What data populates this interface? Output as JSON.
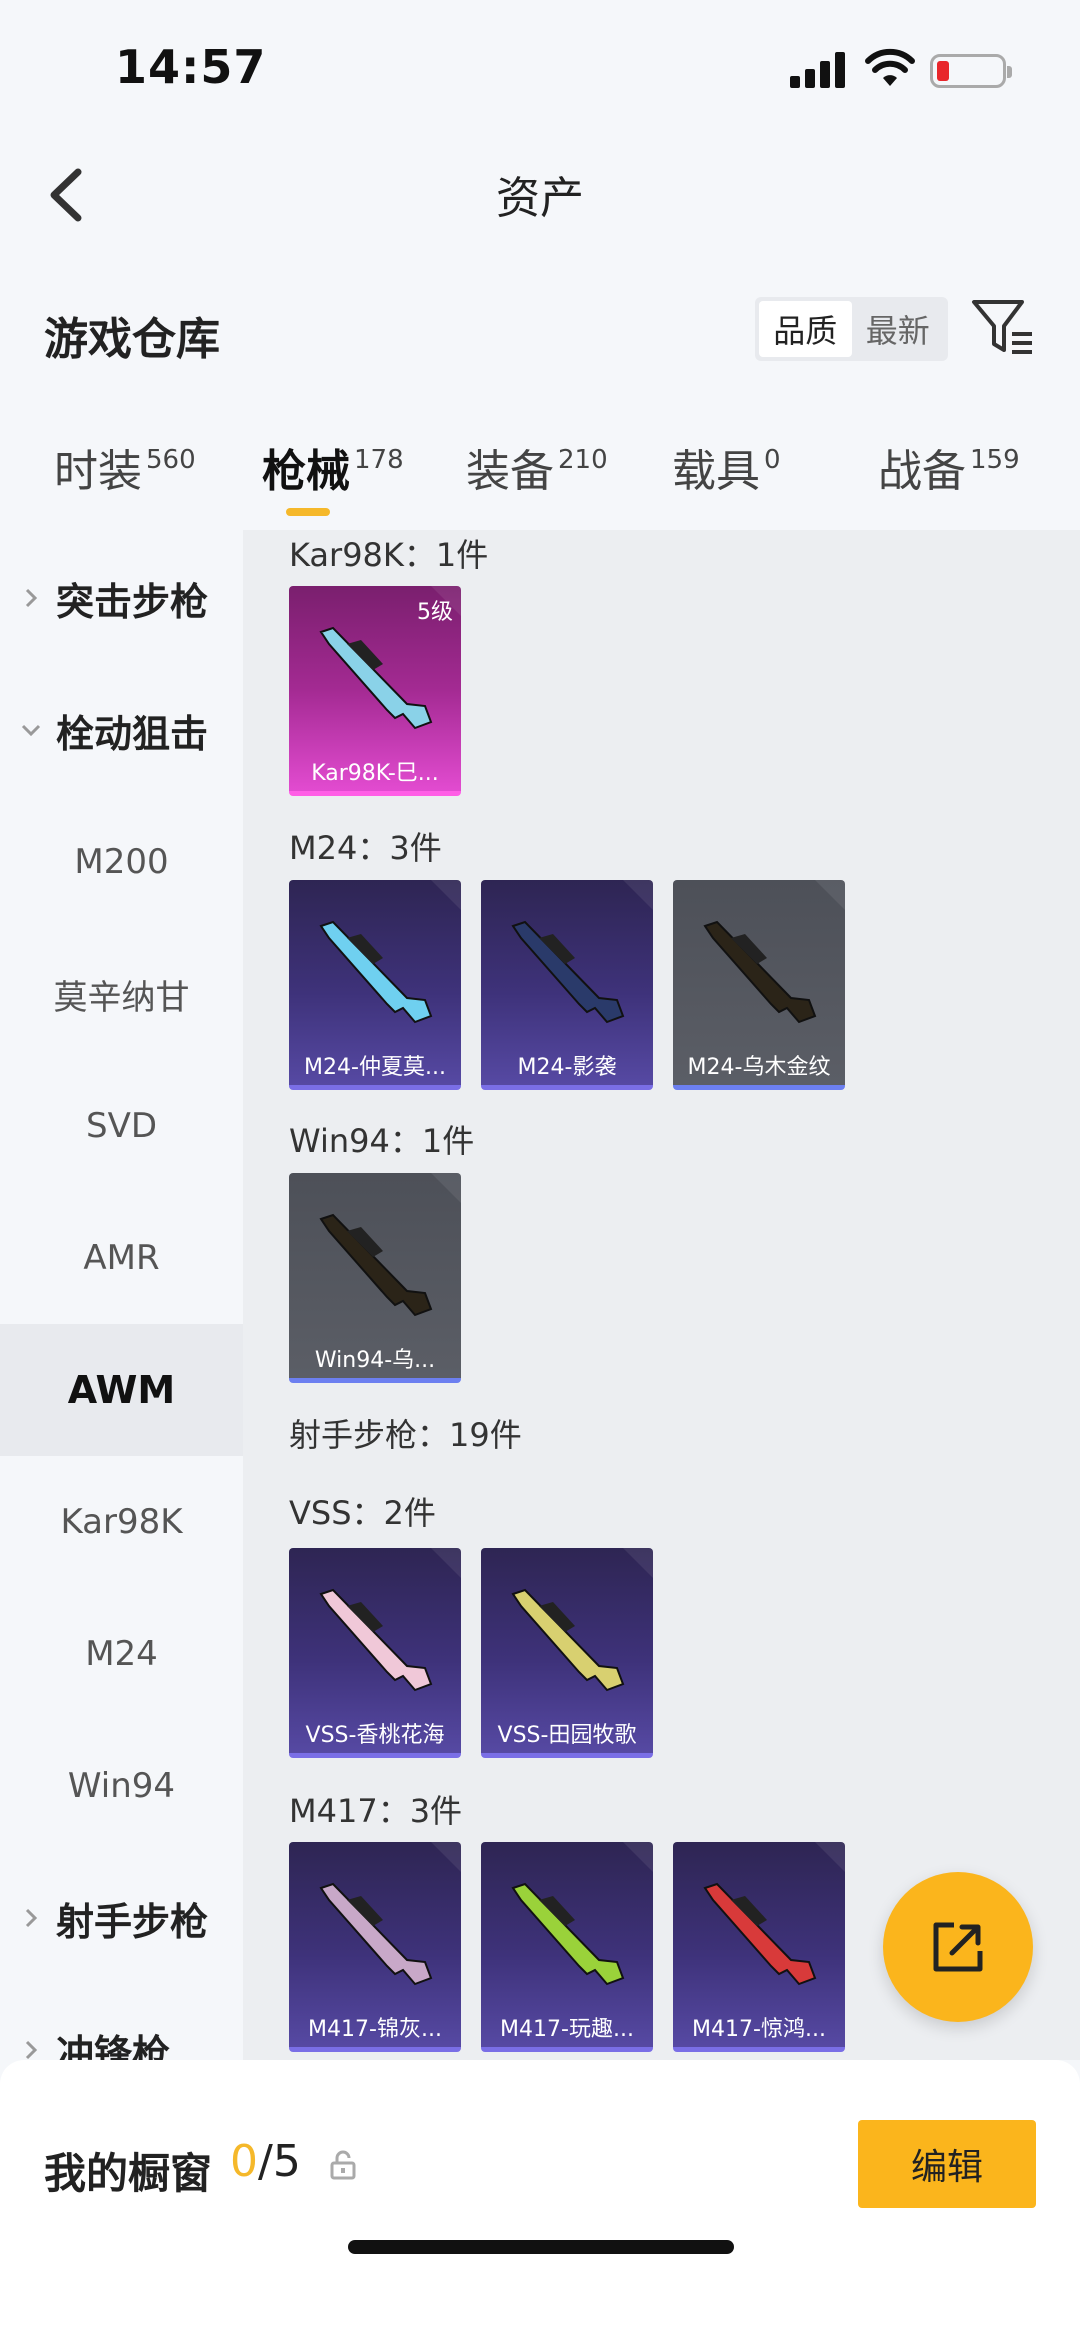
{
  "status_bar": {
    "time": "14:57"
  },
  "nav": {
    "title": "资产"
  },
  "header": {
    "title": "游戏仓库",
    "sort_options": [
      "品质",
      "最新"
    ]
  },
  "tabs": [
    {
      "label": "时装",
      "count": "560"
    },
    {
      "label": "枪械",
      "count": "178"
    },
    {
      "label": "装备",
      "count": "210"
    },
    {
      "label": "载具",
      "count": "0"
    },
    {
      "label": "战备",
      "count": "159"
    }
  ],
  "sidebar": [
    {
      "label": "突击步枪",
      "type": "group",
      "expanded": false
    },
    {
      "label": "栓动狙击",
      "type": "group",
      "expanded": true
    },
    {
      "label": "M200"
    },
    {
      "label": "莫辛纳甘"
    },
    {
      "label": "SVD"
    },
    {
      "label": "AMR"
    },
    {
      "label": "AWM",
      "active": true
    },
    {
      "label": "Kar98K"
    },
    {
      "label": "M24"
    },
    {
      "label": "Win94"
    },
    {
      "label": "射手步枪",
      "type": "group",
      "expanded": false
    },
    {
      "label": "冲锋枪",
      "type": "group",
      "expanded": false
    }
  ],
  "groups": [
    {
      "label": "Kar98K：1件",
      "items": [
        {
          "name": "Kar98K-巳...",
          "level": "5级",
          "style": "magenta",
          "gun_color": "#8ad2e8"
        }
      ]
    },
    {
      "label": "M24：3件",
      "items": [
        {
          "name": "M24-仲夏莫...",
          "style": "purple",
          "gun_color": "#6fd0f0"
        },
        {
          "name": "M24-影袭",
          "style": "purple",
          "gun_color": "#2a3a6a"
        },
        {
          "name": "M24-乌木金纹",
          "style": "gray",
          "gun_color": "#2b2418"
        }
      ]
    },
    {
      "label": "Win94：1件",
      "items": [
        {
          "name": "Win94-乌...",
          "style": "gray",
          "gun_color": "#2b2418"
        }
      ]
    },
    {
      "label": "射手步枪：19件",
      "items": []
    },
    {
      "label": "VSS：2件",
      "items": [
        {
          "name": "VSS-香桃花海",
          "style": "purple",
          "gun_color": "#f0c8d8"
        },
        {
          "name": "VSS-田园牧歌",
          "style": "purple",
          "gun_color": "#d8d070"
        }
      ]
    },
    {
      "label": "M417：3件",
      "items": [
        {
          "name": "M417-锦灰...",
          "style": "purple",
          "gun_color": "#c8a8c8"
        },
        {
          "name": "M417-玩趣...",
          "style": "purple",
          "gun_color": "#9ad23a"
        },
        {
          "name": "M417-惊鸿...",
          "style": "purple",
          "gun_color": "#d83a3a"
        }
      ]
    }
  ],
  "showcase": {
    "label": "我的橱窗",
    "current": "0",
    "total": "/5",
    "edit_label": "编辑"
  },
  "colors": {
    "accent": "#fbb51c",
    "tab_underline": "#f5b82a"
  }
}
